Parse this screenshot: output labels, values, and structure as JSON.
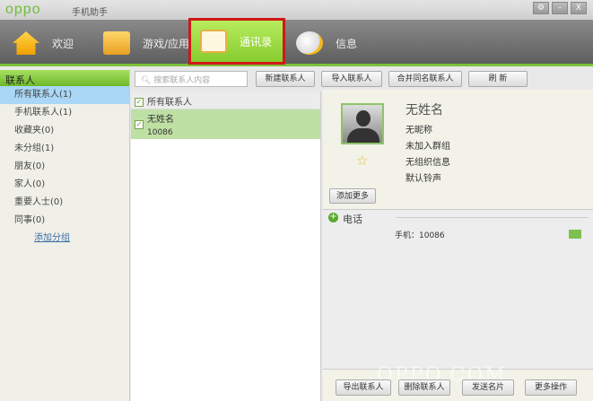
{
  "app": {
    "logo": "oppo",
    "title": "手机助手",
    "settings": "⚙",
    "minimize": "–",
    "close": "X"
  },
  "nav": [
    {
      "label": "欢迎",
      "icon": "home-icon"
    },
    {
      "label": "游戏/应用",
      "icon": "box-icon"
    },
    {
      "label": "通讯录",
      "icon": "contacts-icon"
    },
    {
      "label": "信息",
      "icon": "chat-icon"
    }
  ],
  "sidebar": {
    "title": "联系人",
    "items": [
      "所有联系人(1)",
      "手机联系人(1)",
      "收藏夹(0)",
      "未分组(1)",
      "朋友(0)",
      "家人(0)",
      "重要人士(0)",
      "同事(0)"
    ],
    "add_group": "添加分组"
  },
  "toolbar": {
    "search_placeholder": "搜索联系人内容",
    "new": "新建联系人",
    "import": "导入联系人",
    "merge": "合并同名联系人",
    "refresh": "刷 新"
  },
  "list": {
    "header": "所有联系人",
    "contacts": [
      {
        "name": "无姓名",
        "number": "10086"
      }
    ]
  },
  "detail": {
    "name": "无姓名",
    "nickname": "无昵称",
    "group": "未加入群组",
    "org": "无组织信息",
    "ringtone": "默认铃声",
    "add_more": "添加更多",
    "phone_section": "电话",
    "phone_label": "手机：10086"
  },
  "actions": {
    "export": "导出联系人",
    "delete": "删除联系人",
    "send_card": "发送名片",
    "more": "更多操作"
  },
  "watermark": "OPPO.COM"
}
